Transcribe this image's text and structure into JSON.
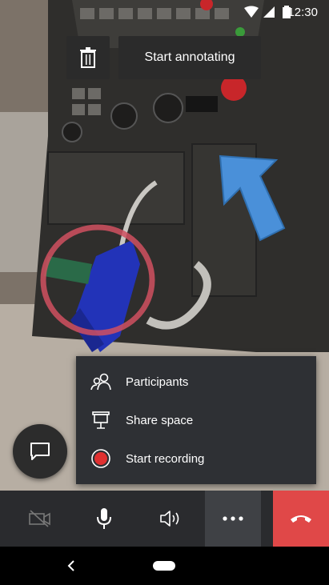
{
  "status_bar": {
    "time": "12:30"
  },
  "annotation": {
    "start_label": "Start annotating"
  },
  "menu": {
    "items": [
      {
        "label": "Participants",
        "icon": "people-icon"
      },
      {
        "label": "Share space",
        "icon": "presentation-icon"
      },
      {
        "label": "Start recording",
        "icon": "record-icon"
      }
    ]
  },
  "colors": {
    "hangup": "#e04848",
    "record": "#e03030",
    "arrow": "#4a90d9",
    "circle": "#d05060"
  }
}
